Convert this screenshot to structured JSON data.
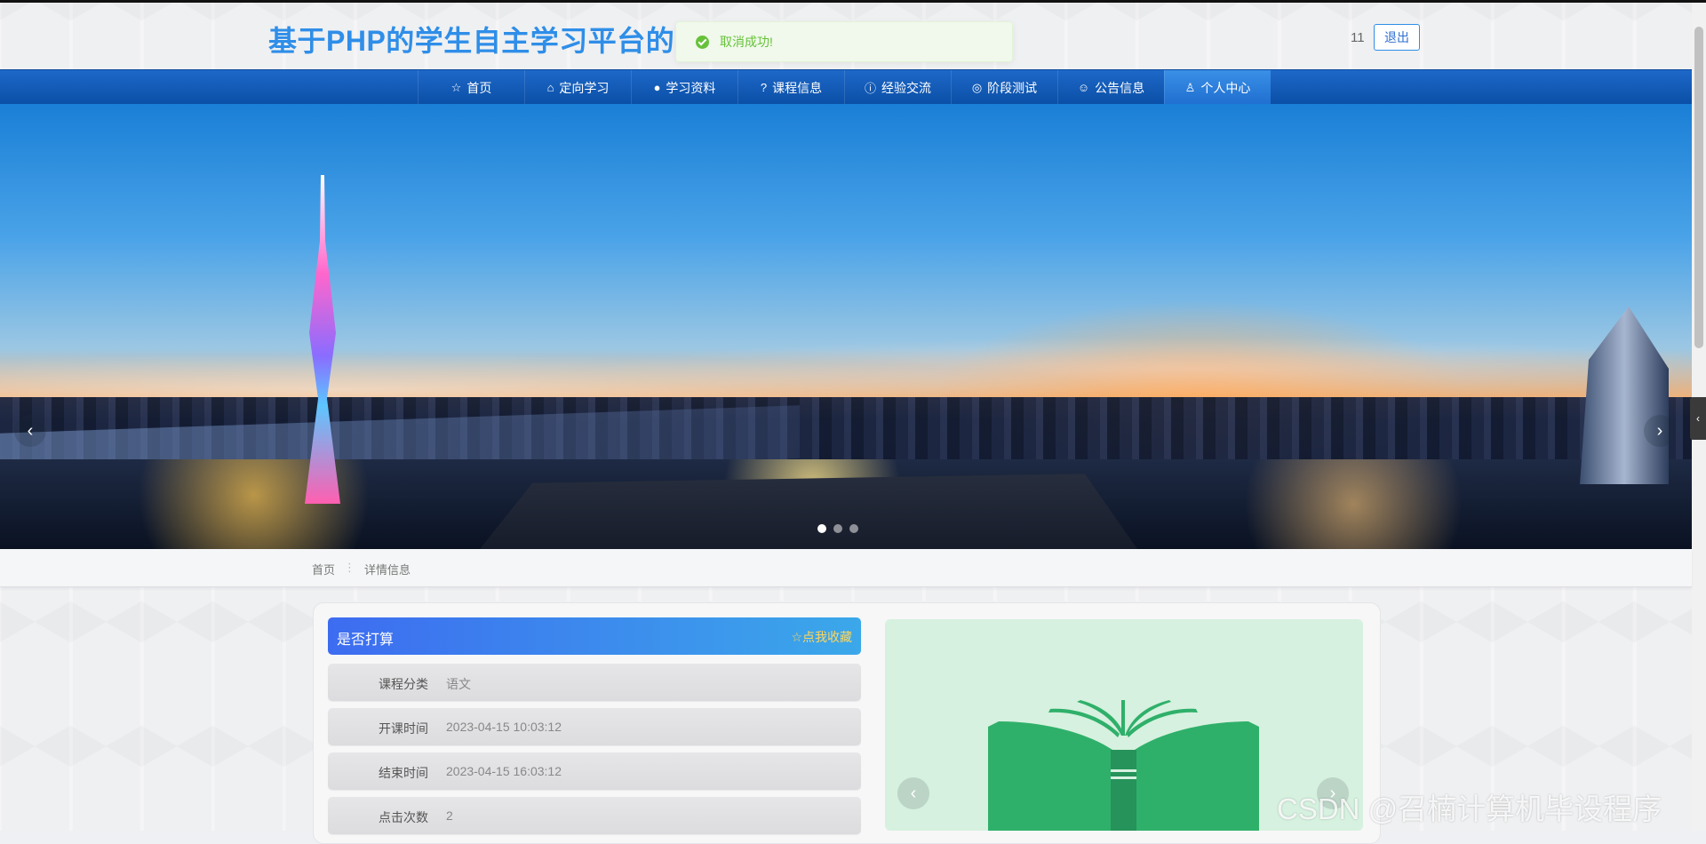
{
  "header": {
    "site_title": "基于PHP的学生自主学习平台的设计与实现",
    "user_name": "11",
    "logout_label": "退出"
  },
  "toast": {
    "message": "取消成功!",
    "type": "success"
  },
  "nav": {
    "items": [
      {
        "icon": "star-icon",
        "glyph": "☆",
        "label": "首页"
      },
      {
        "icon": "bag-icon",
        "glyph": "⌂",
        "label": "定向学习"
      },
      {
        "icon": "info-icon",
        "glyph": "●",
        "label": "学习资料"
      },
      {
        "icon": "question-icon",
        "glyph": "?",
        "label": "课程信息"
      },
      {
        "icon": "info-circle-icon",
        "glyph": "ⓘ",
        "label": "经验交流"
      },
      {
        "icon": "target-icon",
        "glyph": "◎",
        "label": "阶段测试"
      },
      {
        "icon": "smile-icon",
        "glyph": "☺",
        "label": "公告信息"
      },
      {
        "icon": "user-icon",
        "glyph": "♙",
        "label": "个人中心"
      }
    ],
    "active_index": 7
  },
  "carousel": {
    "slide_count": 3,
    "active_slide": 0
  },
  "breadcrumb": {
    "items": [
      "首页",
      "详情信息"
    ],
    "separator": "⋮"
  },
  "detail": {
    "title": "是否打算",
    "favorite_label": "☆点我收藏",
    "fields": [
      {
        "label": "课程分类",
        "value": "语文"
      },
      {
        "label": "开课时间",
        "value": "2023-04-15 10:03:12"
      },
      {
        "label": "结束时间",
        "value": "2023-04-15 16:03:12"
      },
      {
        "label": "点击次数",
        "value": "2"
      }
    ]
  },
  "watermark": "CSDN @召楠计算机毕设程序",
  "colors": {
    "brand": "#2f8ee8",
    "nav_bg": "#0a4fa6",
    "success": "#67c23a",
    "book_green": "#2fb06a"
  }
}
